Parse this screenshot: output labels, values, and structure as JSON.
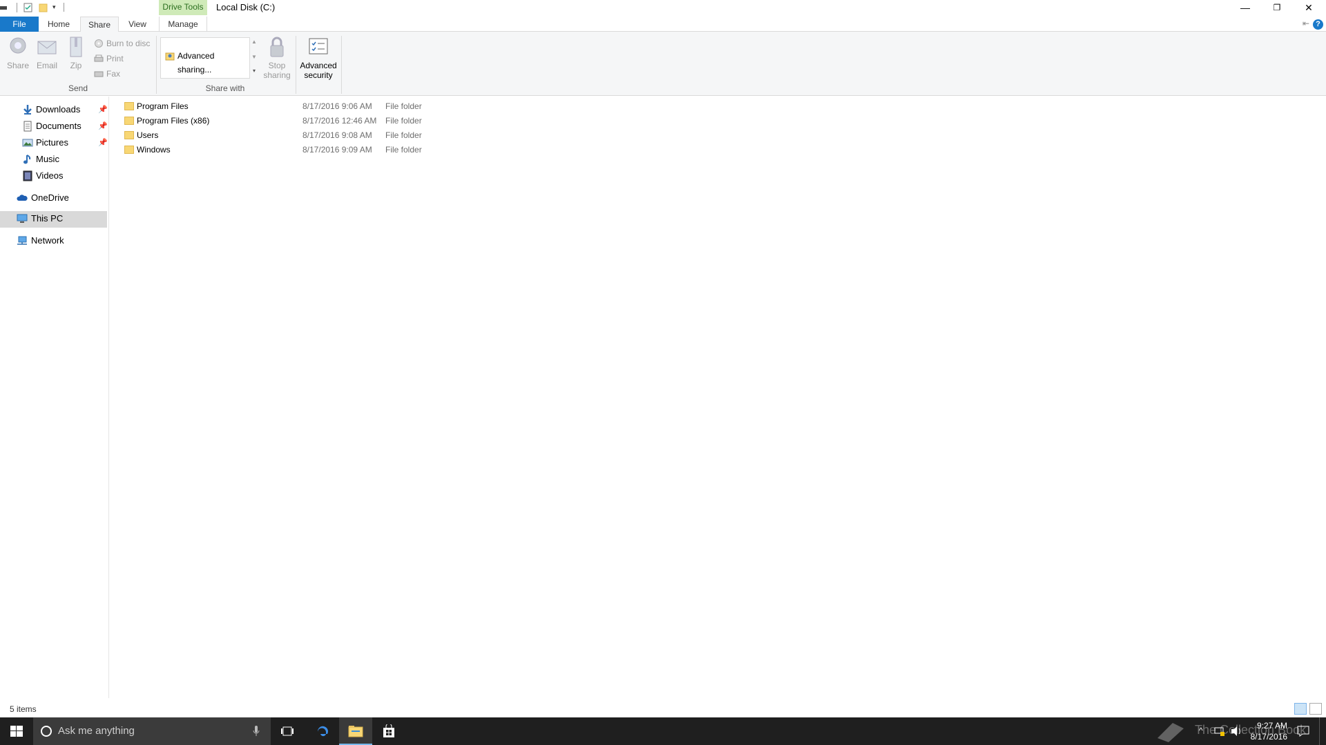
{
  "window": {
    "title": "Local Disk (C:)",
    "contextual_tab": "Drive Tools",
    "controls": {
      "minimize": "—",
      "restore": "❐",
      "close": "✕"
    }
  },
  "tabs": [
    {
      "label": "File"
    },
    {
      "label": "Home"
    },
    {
      "label": "Share"
    },
    {
      "label": "View"
    },
    {
      "label": "Manage"
    }
  ],
  "ribbon": {
    "send_group": {
      "label": "Send",
      "share": "Share",
      "email": "Email",
      "zip": "Zip",
      "burn": "Burn to disc",
      "print": "Print",
      "fax": "Fax"
    },
    "share_with_group": {
      "label": "Share with",
      "advanced_sharing": "Advanced sharing...",
      "stop_sharing_line1": "Stop",
      "stop_sharing_line2": "sharing"
    },
    "advanced_security_line1": "Advanced",
    "advanced_security_line2": "security"
  },
  "nav": {
    "items": [
      {
        "label": "Downloads",
        "icon": "download-arrow-icon",
        "pinned": true
      },
      {
        "label": "Documents",
        "icon": "document-icon",
        "pinned": true
      },
      {
        "label": "Pictures",
        "icon": "pictures-icon",
        "pinned": true
      },
      {
        "label": "Music",
        "icon": "music-note-icon",
        "pinned": false
      },
      {
        "label": "Videos",
        "icon": "video-icon",
        "pinned": false
      },
      {
        "label": "OneDrive",
        "icon": "cloud-icon",
        "pinned": false
      },
      {
        "label": "This PC",
        "icon": "monitor-icon",
        "pinned": false,
        "selected": true
      },
      {
        "label": "Network",
        "icon": "network-icon",
        "pinned": false
      }
    ]
  },
  "files": [
    {
      "name": "Program Files",
      "date": "8/17/2016 9:06 AM",
      "type": "File folder"
    },
    {
      "name": "Program Files (x86)",
      "date": "8/17/2016 12:46 AM",
      "type": "File folder"
    },
    {
      "name": "Users",
      "date": "8/17/2016 9:08 AM",
      "type": "File folder"
    },
    {
      "name": "Windows",
      "date": "8/17/2016 9:09 AM",
      "type": "File folder"
    }
  ],
  "status": {
    "item_count": "5 items"
  },
  "taskbar": {
    "search_placeholder": "Ask me anything",
    "time": "9:27 AM",
    "date": "8/17/2016",
    "watermark": "The Collection Book"
  },
  "colors": {
    "accent": "#1979ca",
    "drive_tools_tab": "#cfeab8",
    "taskbar": "#1f1f1f",
    "selected_nav": "#d9d9d9"
  }
}
